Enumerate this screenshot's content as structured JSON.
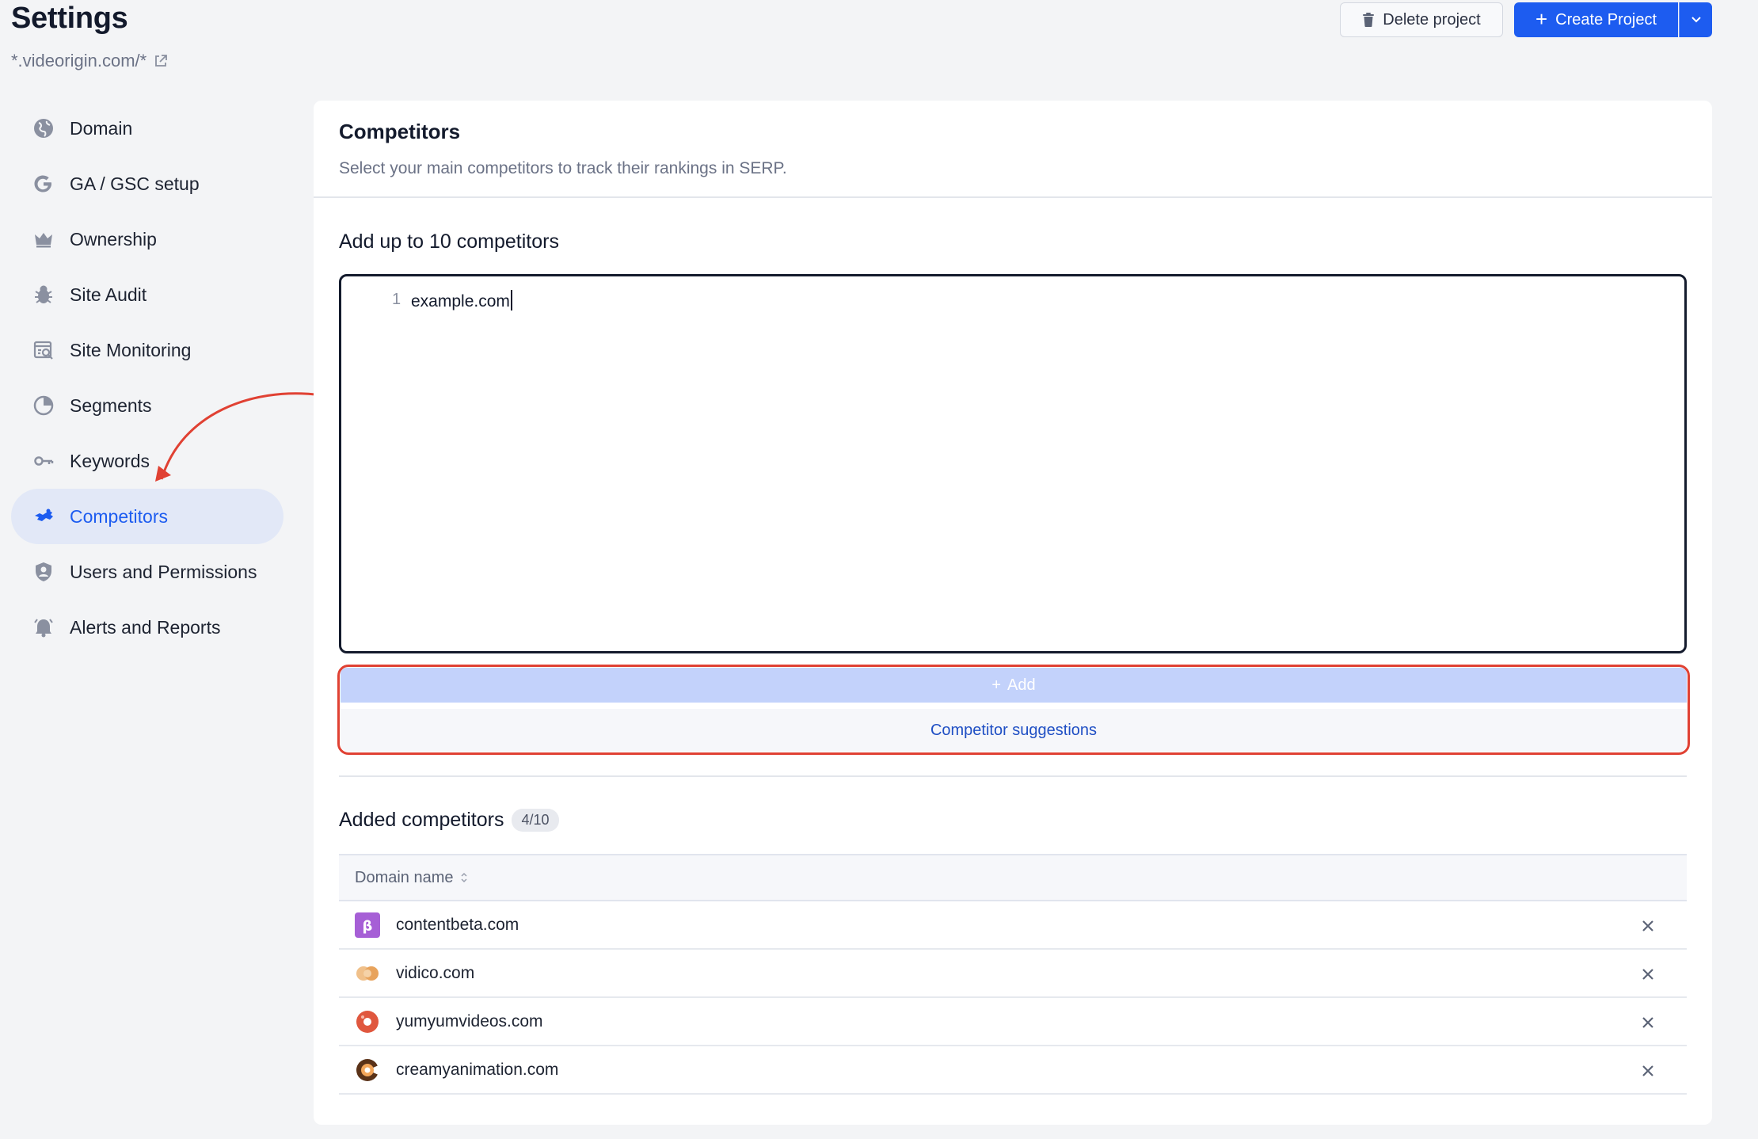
{
  "header": {
    "title": "Settings",
    "domain": "*.videorigin.com/*",
    "delete_label": "Delete project",
    "create_label": "Create Project",
    "create_plus": "+"
  },
  "sidebar": {
    "items": [
      {
        "label": "Domain",
        "icon": "globe-icon"
      },
      {
        "label": "GA / GSC setup",
        "icon": "google-icon"
      },
      {
        "label": "Ownership",
        "icon": "crown-icon"
      },
      {
        "label": "Site Audit",
        "icon": "bug-icon"
      },
      {
        "label": "Site Monitoring",
        "icon": "monitor-search-icon"
      },
      {
        "label": "Segments",
        "icon": "pie-icon"
      },
      {
        "label": "Keywords",
        "icon": "key-icon"
      },
      {
        "label": "Competitors",
        "icon": "competitors-icon",
        "active": true
      },
      {
        "label": "Users and Permissions",
        "icon": "shield-user-icon"
      },
      {
        "label": "Alerts and Reports",
        "icon": "alarm-bell-icon"
      }
    ]
  },
  "main": {
    "title": "Competitors",
    "subtitle": "Select your main competitors to track their rankings in SERP.",
    "add_heading": "Add up to 10 competitors",
    "editor": {
      "line_number": "1",
      "text": "example.com"
    },
    "add_button": "Add",
    "add_plus": "+",
    "suggest_button": "Competitor suggestions",
    "added_heading": "Added competitors",
    "count": "4/10",
    "table": {
      "column": "Domain name",
      "rows": [
        {
          "domain": "contentbeta.com",
          "favicon_glyph": "β"
        },
        {
          "domain": "vidico.com"
        },
        {
          "domain": "yumyumvideos.com"
        },
        {
          "domain": "creamyanimation.com"
        }
      ]
    }
  },
  "colors": {
    "accent": "#1d5cf0",
    "active_bg": "#e2e8f7",
    "highlight": "#e04133",
    "add_button_bg": "#c3d2fb"
  }
}
